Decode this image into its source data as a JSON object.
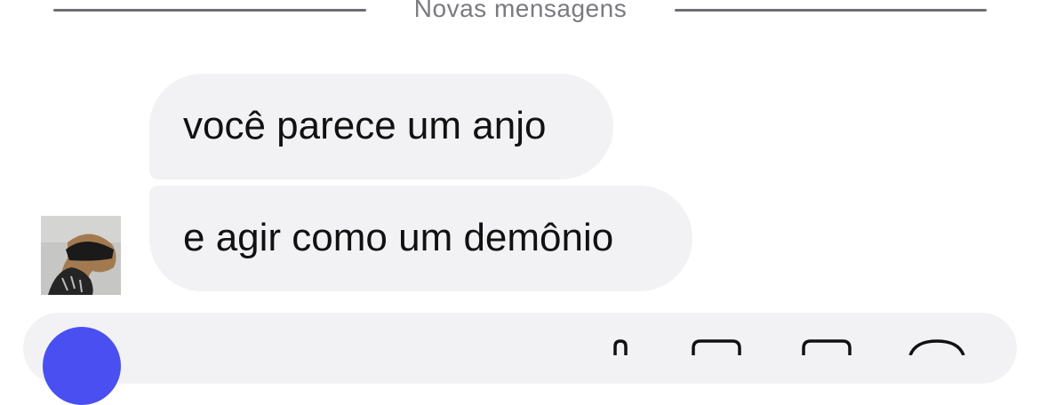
{
  "divider": {
    "label": "Novas mensagens"
  },
  "messages": [
    {
      "text": "você parece um anjo"
    },
    {
      "text": "e agir como um demônio"
    }
  ],
  "composer": {
    "camera_button_color": "#4a4ff2",
    "icons": [
      "microphone-icon",
      "image-icon",
      "sticker-icon",
      "add-icon"
    ]
  }
}
